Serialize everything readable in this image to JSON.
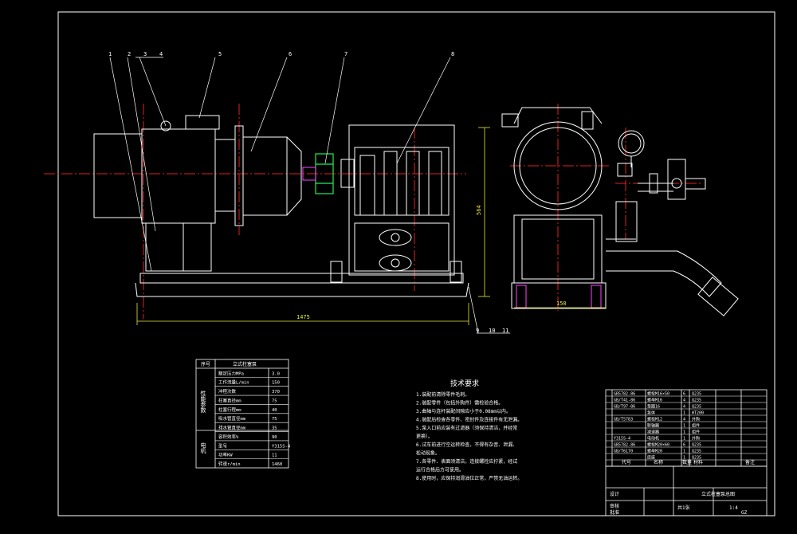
{
  "callouts": [
    "1",
    "2",
    "3",
    "4",
    "5",
    "6",
    "7",
    "8",
    "9",
    "10",
    "11"
  ],
  "dimensions": {
    "length": "1475",
    "height": "564",
    "width": "150"
  },
  "param_table": {
    "header": [
      "序号",
      "立式柱塞泵"
    ],
    "group1_label": "性能参数",
    "group2_label": "电机",
    "rows": [
      {
        "name": "额定压力MPa",
        "value": "3.0"
      },
      {
        "name": "工作流量L/min",
        "value": "150"
      },
      {
        "name": "冲程次数",
        "value": "370"
      },
      {
        "name": "柱塞直径mm",
        "value": "75"
      },
      {
        "name": "柱塞行程mm",
        "value": "40"
      },
      {
        "name": "吸水管直径mm",
        "value": "75"
      },
      {
        "name": "排水管直径mm",
        "value": "35"
      },
      {
        "name": "容积效率%",
        "value": "90"
      },
      {
        "name": "型号",
        "value": "Y315S-4"
      },
      {
        "name": "功率KW",
        "value": "11"
      },
      {
        "name": "转速r/min",
        "value": "1460"
      }
    ]
  },
  "tech_requirements": {
    "title": "技术要求",
    "lines": [
      "1.装配前清除零件毛刺。",
      "2.装配零件（包括外购件）需检验合格。",
      "3.曲轴与连杆装配间隙应小于0.08mm以内。",
      "4.装配后检查各零件、密封件及连接件有无泄漏。",
      "5.泵入口前应装有过滤器（须保持清洁，并经常",
      "  更换）。",
      "6.试车前进行空运转检查，不得有杂音、泄漏、",
      "  松动现象。",
      "7.各零件、表面须清洁，连接螺栓应拧紧，经试",
      "  运行合格后方可使用。",
      "8.使用时，应保持润滑油位正常，严禁无油运转。"
    ]
  },
  "parts_list": {
    "rows": [
      {
        "code": "GB5782-86",
        "name": "螺栓M16×50",
        "qty": "6",
        "mat": "Q235"
      },
      {
        "code": "GB/T41-86",
        "name": "螺母M16",
        "qty": "4",
        "mat": "Q235"
      },
      {
        "code": "GB/T97-86",
        "name": "垫圈16",
        "qty": "4",
        "mat": "Q235"
      },
      {
        "code": "",
        "name": "泵体",
        "qty": "1",
        "mat": "HT200"
      },
      {
        "code": "GB/T5783",
        "name": "螺栓M12",
        "qty": "4",
        "mat": "外购"
      },
      {
        "code": "",
        "name": "联轴器",
        "qty": "1",
        "mat": "组件"
      },
      {
        "code": "",
        "name": "减速器",
        "qty": "1",
        "mat": "组件"
      },
      {
        "code": "Y315S-4",
        "name": "电动机",
        "qty": "1",
        "mat": "外购"
      },
      {
        "code": "GB5782-86",
        "name": "螺栓M20×60",
        "qty": "6",
        "mat": "Q235"
      },
      {
        "code": "GB/T6170",
        "name": "螺母M20",
        "qty": "1",
        "mat": "Q235"
      },
      {
        "code": "",
        "name": "底座",
        "qty": "1",
        "mat": "Q235"
      }
    ],
    "header": {
      "code": "代号",
      "name": "名称",
      "qty": "数量",
      "mat": "材料",
      "note": "备注"
    }
  },
  "title_block": {
    "school_label": "设计",
    "drawing_title": "立式柱塞泵总图",
    "scale": "1:4",
    "sheet": "共1张",
    "check": "审核",
    "approve": "批准",
    "drawing_no": "GZ"
  }
}
